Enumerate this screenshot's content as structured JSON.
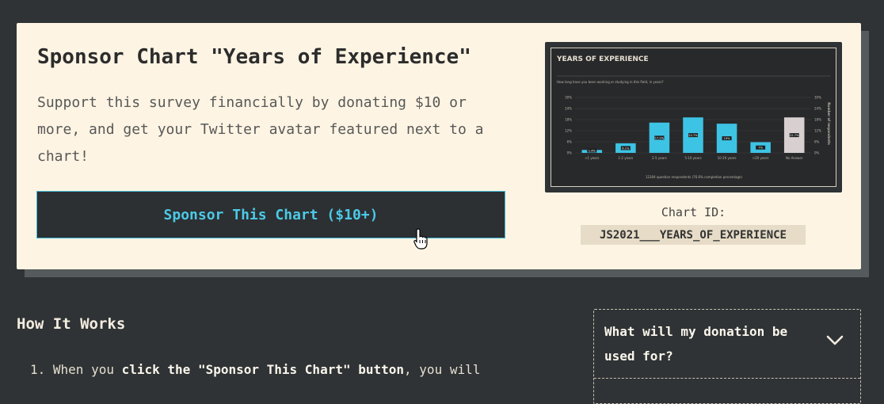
{
  "sponsor": {
    "title": "Sponsor Chart \"Years of Experience\"",
    "description": "Support this survey financially by donating $10 or more, and get your Twitter avatar featured next to a chart!",
    "button_label": "Sponsor This Chart ($10+)",
    "chart_id_label": "Chart ID:",
    "chart_id": "JS2021___YEARS_OF_EXPERIENCE"
  },
  "thumbnail": {
    "title": "YEARS OF EXPERIENCE",
    "question": "How long have you been working or studying in this field, in years?",
    "footnote": "12304 question respondents (76.6% completion percentage)",
    "right_axis_label": "Number of respondents",
    "chart_data": {
      "type": "bar",
      "categories": [
        "<1 years",
        "1-2 years",
        "2-5 years",
        "5-10 years",
        "10-20 years",
        ">20 years",
        "No Answer"
      ],
      "values": [
        0.8,
        2.6,
        8.2,
        9.6,
        7.9,
        2.9,
        9.6
      ],
      "data_labels": [
        "1.4%",
        "6.1%",
        "17.9%",
        "22.7%",
        "19%",
        "7%",
        "22.7%"
      ],
      "y_ticks_left": [
        "0%",
        "6%",
        "12%",
        "18%",
        "24%",
        "30%"
      ],
      "y_ticks_right": [
        "0%",
        "6%",
        "12%",
        "18%",
        "24%",
        "30%"
      ],
      "ylim": [
        0,
        15
      ],
      "colors": {
        "bar": "#3dc3e3",
        "highlight": "#d8d0d0",
        "background": "#28292b"
      }
    }
  },
  "how": {
    "title": "How It Works",
    "step1_num": "1.",
    "step1_pre": "When you ",
    "step1_bold": "click the \"Sponsor This Chart\" button",
    "step1_post": ", you will"
  },
  "faq": {
    "question": "What will my donation be used for?",
    "icon": "chevron-down-icon"
  }
}
